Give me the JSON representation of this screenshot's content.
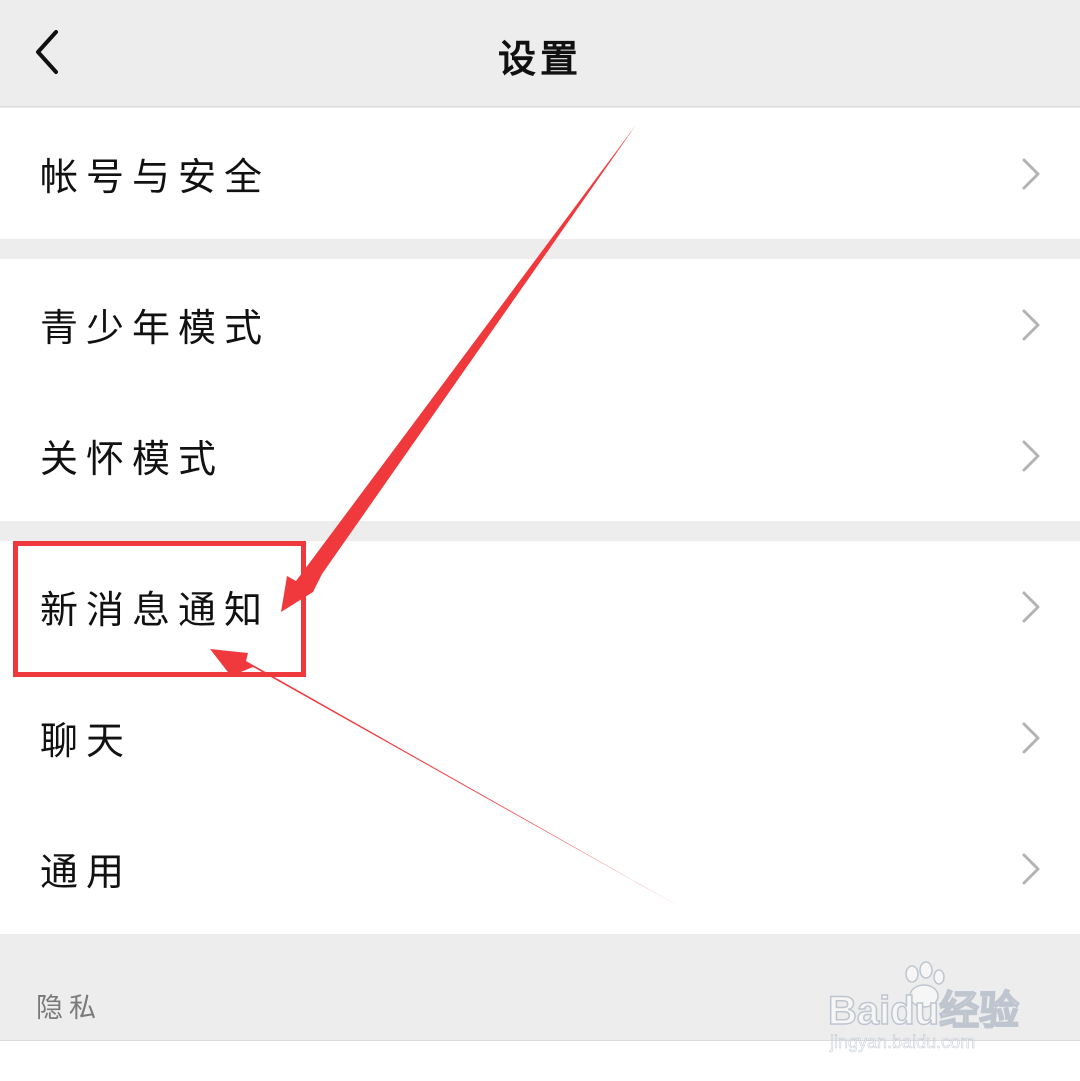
{
  "header": {
    "title": "设置",
    "back_icon": "chevron-left-icon"
  },
  "groups": [
    {
      "items": [
        {
          "label": "帐号与安全"
        }
      ]
    },
    {
      "items": [
        {
          "label": "青少年模式"
        },
        {
          "label": "关怀模式"
        }
      ]
    },
    {
      "items": [
        {
          "label": "新消息通知"
        },
        {
          "label": "聊天"
        },
        {
          "label": "通用"
        }
      ]
    }
  ],
  "section": {
    "privacy_label": "隐私"
  },
  "annotation": {
    "highlighted_item": "新消息通知",
    "accent_color": "#f0393c"
  },
  "watermark": {
    "brand": "Baidu经验",
    "url": "jingyan.baidu.com"
  }
}
